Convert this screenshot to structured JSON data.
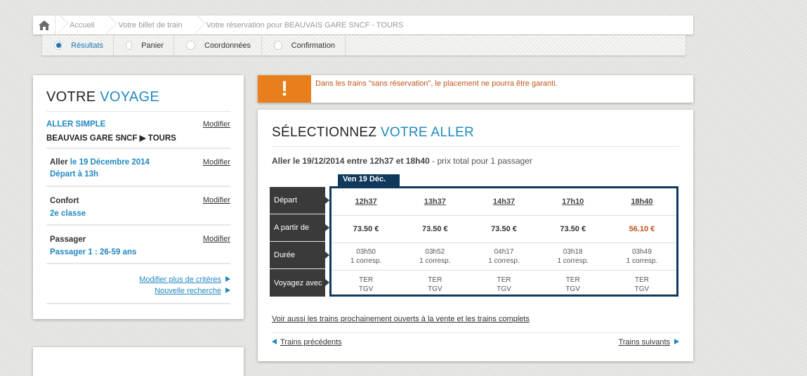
{
  "breadcrumb": {
    "items": [
      "Accueil",
      "Votre billet de train",
      "Votre réservation pour BEAUVAIS GARE SNCF - TOURS"
    ]
  },
  "steps": [
    {
      "label": "Résultats",
      "active": true
    },
    {
      "label": "Panier",
      "active": false
    },
    {
      "label": "Coordonnées",
      "active": false
    },
    {
      "label": "Confirmation",
      "active": false
    }
  ],
  "voyage": {
    "title_a": "VOTRE ",
    "title_b": "VOYAGE",
    "modify_label": "Modifier",
    "trip_type": "ALLER SIMPLE",
    "route_from": "BEAUVAIS GARE SNCF",
    "route_to": "TOURS",
    "aller_label": "Aller",
    "aller_date": "le 19 Décembre 2014",
    "depart": "Départ à 13h",
    "confort_label": "Confort",
    "confort_value": "2e classe",
    "passager_label": "Passager",
    "passager_value": "Passager 1 : 26-59 ans",
    "link_more": "Modifier plus de critères",
    "link_new": "Nouvelle recherche"
  },
  "alert": {
    "icon": "!",
    "text": "Dans les trains \"sans réservation\", le placement ne pourra être garanti."
  },
  "main": {
    "title_a": "SÉLECTIONNEZ ",
    "title_b": "VOTRE ALLER",
    "summary_bold": "Aller le 19/12/2014 entre 12h37 et 18h40",
    "summary_rest": " - prix total pour 1 passager",
    "date_tab": "Ven 19 Déc.",
    "row_labels": [
      "Départ",
      "A partir de",
      "Durée",
      "Voyagez avec"
    ],
    "trains": [
      {
        "time": "12h37",
        "price": "73.50 €",
        "duration": "03h50",
        "corresp": "1 corresp.",
        "mode1": "TER",
        "mode2": "TGV"
      },
      {
        "time": "13h37",
        "price": "73.50 €",
        "duration": "03h52",
        "corresp": "1 corresp.",
        "mode1": "TER",
        "mode2": "TGV"
      },
      {
        "time": "14h37",
        "price": "73.50 €",
        "duration": "04h17",
        "corresp": "1 corresp.",
        "mode1": "TER",
        "mode2": "TGV"
      },
      {
        "time": "17h10",
        "price": "73.50 €",
        "duration": "03h18",
        "corresp": "1 corresp.",
        "mode1": "TER",
        "mode2": "TGV"
      },
      {
        "time": "18h40",
        "price": "56.10 €",
        "duration": "03h49",
        "corresp": "1 corresp.",
        "mode1": "TER",
        "mode2": "TGV"
      }
    ],
    "voir_aussi": "Voir aussi les trains prochainement ouverts à la vente et les trains complets",
    "prev_label": "Trains précédents",
    "next_label": "Trains suivants"
  },
  "colors": {
    "accent": "#2288c0",
    "warning": "#e97f1c",
    "grid_frame": "#0f3a5c",
    "cheapest": "#c0561a"
  }
}
